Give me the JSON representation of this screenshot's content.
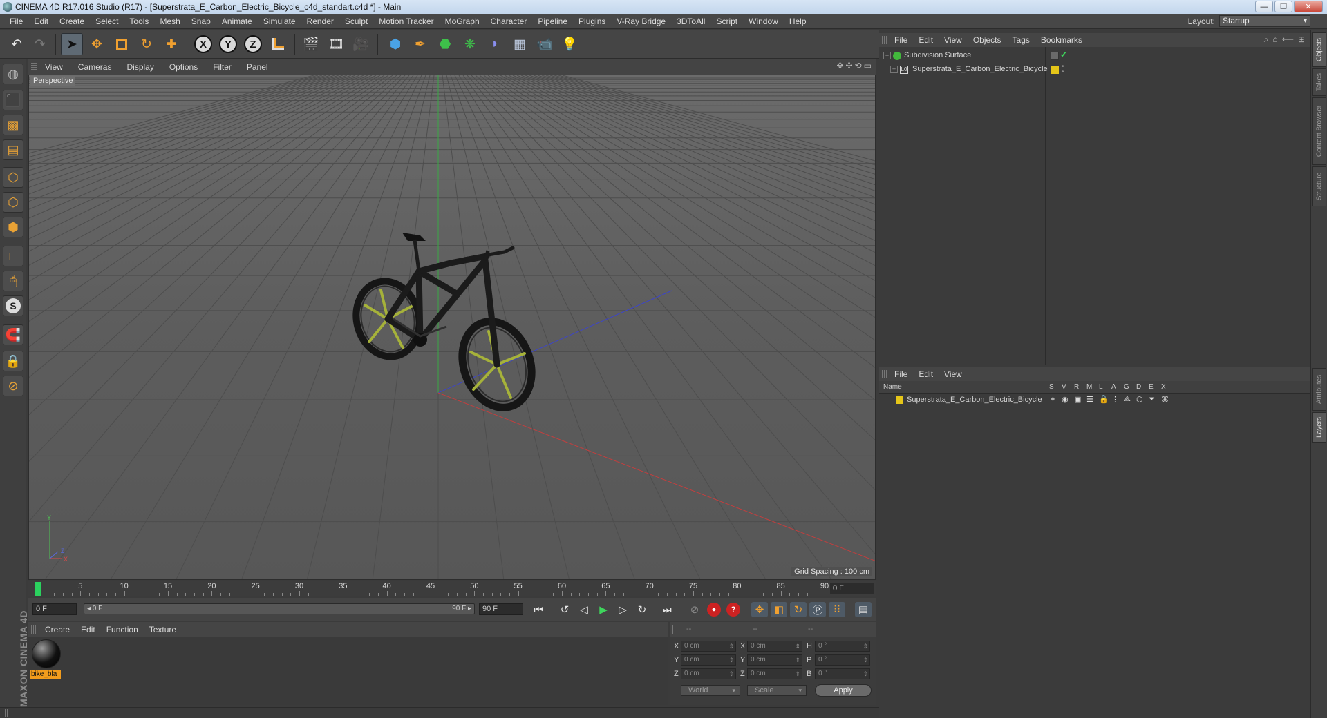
{
  "window": {
    "title": "CINEMA 4D R17.016 Studio (R17) - [Superstrata_E_Carbon_Electric_Bicycle_c4d_standart.c4d *] - Main",
    "controls": [
      "—",
      "❐",
      "✕"
    ]
  },
  "menubar": {
    "items": [
      "File",
      "Edit",
      "Create",
      "Select",
      "Tools",
      "Mesh",
      "Snap",
      "Animate",
      "Simulate",
      "Render",
      "Sculpt",
      "Motion Tracker",
      "MoGraph",
      "Character",
      "Pipeline",
      "Plugins",
      "V-Ray Bridge",
      "3DToAll",
      "Script",
      "Window",
      "Help"
    ],
    "layout_label": "Layout:",
    "layout_value": "Startup"
  },
  "toolbar": {
    "axis_x": "X",
    "axis_y": "Y",
    "axis_z": "Z"
  },
  "viewport": {
    "menu": [
      "View",
      "Cameras",
      "Display",
      "Options",
      "Filter",
      "Panel"
    ],
    "camera_label": "Perspective",
    "grid_spacing": "Grid Spacing : 100 cm",
    "mini_axis": {
      "y": "Y",
      "z": "Z",
      "x": "X"
    }
  },
  "timeline": {
    "labels": [
      "0",
      "5",
      "10",
      "15",
      "20",
      "25",
      "30",
      "35",
      "40",
      "45",
      "50",
      "55",
      "60",
      "65",
      "70",
      "75",
      "80",
      "85",
      "90"
    ],
    "current_frame": 0,
    "current_frame_field": "0 F",
    "start_field": "0 F",
    "range_start": "◂ 0 F",
    "range_end": "90 F ▸",
    "end_field": "90 F"
  },
  "materials": {
    "menu": [
      "Create",
      "Edit",
      "Function",
      "Texture"
    ],
    "items": [
      {
        "name": "bike_bla"
      }
    ]
  },
  "coordinates": {
    "headers": [
      "--",
      "--",
      "--"
    ],
    "rows": [
      {
        "a": "X",
        "av": "0 cm",
        "b": "X",
        "bv": "0 cm",
        "c": "H",
        "cv": "0 °"
      },
      {
        "a": "Y",
        "av": "0 cm",
        "b": "Y",
        "bv": "0 cm",
        "c": "P",
        "cv": "0 °"
      },
      {
        "a": "Z",
        "av": "0 cm",
        "b": "Z",
        "bv": "0 cm",
        "c": "B",
        "cv": "0 °"
      }
    ],
    "mode_world": "World",
    "mode_scale": "Scale",
    "apply": "Apply"
  },
  "objects": {
    "menu": [
      "File",
      "Edit",
      "View",
      "Objects",
      "Tags",
      "Bookmarks"
    ],
    "items": [
      {
        "name": "Subdivision Surface",
        "tree": "−",
        "icon_color": "#42b83c"
      },
      {
        "name": "Superstrata_E_Carbon_Electric_Bicycle",
        "tree": "+",
        "icon_color": "#d8d8d8"
      }
    ]
  },
  "layers": {
    "menu": [
      "File",
      "Edit",
      "View"
    ],
    "columns": [
      "Name",
      "S",
      "V",
      "R",
      "M",
      "L",
      "A",
      "G",
      "D",
      "E",
      "X"
    ],
    "items": [
      {
        "name": "Superstrata_E_Carbon_Electric_Bicycle",
        "color": "#e6c619"
      }
    ]
  },
  "right_tabs": [
    "Objects",
    "Takes",
    "Content Browser",
    "Structure",
    "Attributes",
    "Layers"
  ],
  "branding": {
    "logo": "MAXON CINEMA 4D"
  },
  "colors": {
    "accent_orange": "#f29c1c",
    "playhead_green": "#2bd15e",
    "layer_yellow": "#e6c619"
  }
}
